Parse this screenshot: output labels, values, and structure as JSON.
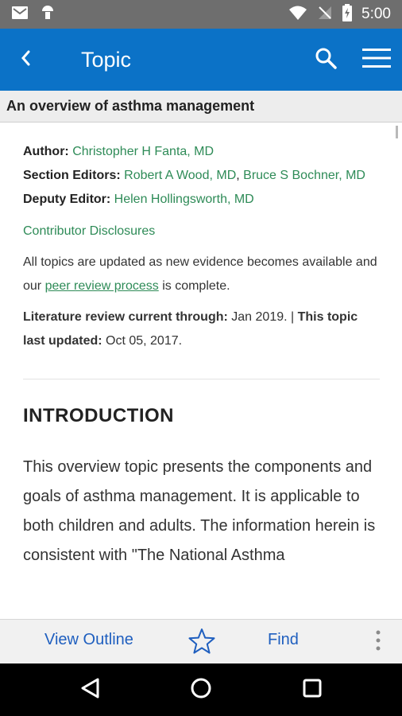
{
  "status_bar": {
    "time": "5:00"
  },
  "app_bar": {
    "title": "Topic"
  },
  "topic_header": {
    "title": "An overview of asthma management"
  },
  "authors": {
    "author_label": "Author:",
    "author": "Christopher H Fanta, MD",
    "section_editors_label": "Section Editors:",
    "section_editor_1": "Robert A Wood, MD",
    "section_editor_sep": ", ",
    "section_editor_2": "Bruce S Bochner, MD",
    "deputy_editor_label": "Deputy Editor:",
    "deputy_editor": "Helen Hollingsworth, MD"
  },
  "contributor_disclosures": "Contributor Disclosures",
  "notice": {
    "before": "All topics are updated as new evidence becomes available and our ",
    "link": "peer review process",
    "after": " is complete."
  },
  "review": {
    "lit_label": "Literature review current through:",
    "lit_value": " Jan 2019. | ",
    "updated_label": "This topic last updated:",
    "updated_value": " Oct 05, 2017."
  },
  "section": {
    "heading": "INTRODUCTION",
    "paragraph": "This overview topic presents the components and goals of asthma management. It is applicable to both children and adults. The information herein is consistent with \"The National Asthma"
  },
  "bottom_bar": {
    "outline_label": "View Outline",
    "find_label": "Find"
  }
}
